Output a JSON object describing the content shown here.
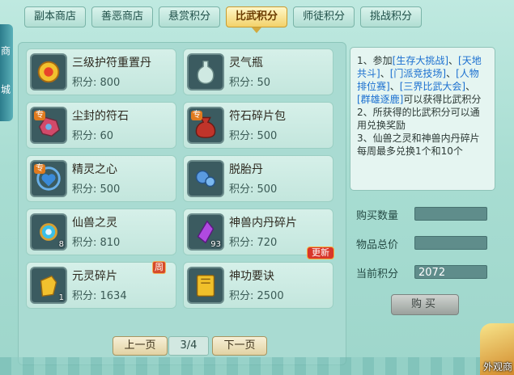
{
  "tabs": [
    {
      "label": "副本商店",
      "active": false
    },
    {
      "label": "善恶商店",
      "active": false
    },
    {
      "label": "悬赏积分",
      "active": false
    },
    {
      "label": "比武积分",
      "active": true
    },
    {
      "label": "师徒积分",
      "active": false
    },
    {
      "label": "挑战积分",
      "active": false
    }
  ],
  "left_strip": {
    "text_1": "商",
    "text_2": "城"
  },
  "items": [
    {
      "name": "三级护符重置丹",
      "price": "积分: 800",
      "icon": "amulet-pill-icon"
    },
    {
      "name": "灵气瓶",
      "price": "积分: 50",
      "icon": "spirit-vase-icon"
    },
    {
      "name": "尘封的符石",
      "price": "积分: 60",
      "icon": "sealed-runestone-icon",
      "badge": "专"
    },
    {
      "name": "符石碎片包",
      "price": "积分: 500",
      "icon": "runestone-bag-icon",
      "badge": "专"
    },
    {
      "name": "精灵之心",
      "price": "积分: 500",
      "icon": "spirit-heart-icon",
      "badge": "专"
    },
    {
      "name": "脱胎丹",
      "price": "积分: 500",
      "icon": "rebirth-pill-icon"
    },
    {
      "name": "仙兽之灵",
      "price": "积分: 810",
      "icon": "beast-spirit-icon",
      "qty": "8"
    },
    {
      "name": "神兽内丹碎片",
      "price": "积分: 720",
      "icon": "beast-core-shard-icon",
      "qty": "93",
      "new": "更新"
    },
    {
      "name": "元灵碎片",
      "price": "积分: 1634",
      "icon": "yuanling-shard-icon",
      "qty": "1",
      "weekly": "周"
    },
    {
      "name": "神功要诀",
      "price": "积分: 2500",
      "icon": "skill-book-icon"
    }
  ],
  "pager": {
    "prev": "上一页",
    "page": "3/4",
    "next": "下一页"
  },
  "info": {
    "p1_prefix": "1、参加",
    "l1": "[生存大挑战]",
    "s1": "、",
    "l2": "[天地共斗]",
    "s2": "、",
    "l3": "[门派竞技场]",
    "s3": "、",
    "l4": "[人物排位赛]",
    "s4": "、",
    "l5": "[三界比武大会]",
    "s5": "、",
    "l6": "[群雄逐鹿]",
    "p1_suffix": "可以获得比武积分",
    "p2": "2、所获得的比武积分可以通用兑换奖励",
    "p3": "3、仙兽之灵和神兽内丹碎片每周最多兑换1个和10个"
  },
  "form": {
    "qty_label": "购买数量",
    "qty_value": "",
    "total_label": "物品总价",
    "total_value": "",
    "points_label": "当前积分",
    "points_value": "2072"
  },
  "buy_label": "购买",
  "corner_label": "外观商",
  "colors": {
    "accent": "#f3d26a",
    "link": "#1a6fd0",
    "field": "#5f8d8b"
  }
}
